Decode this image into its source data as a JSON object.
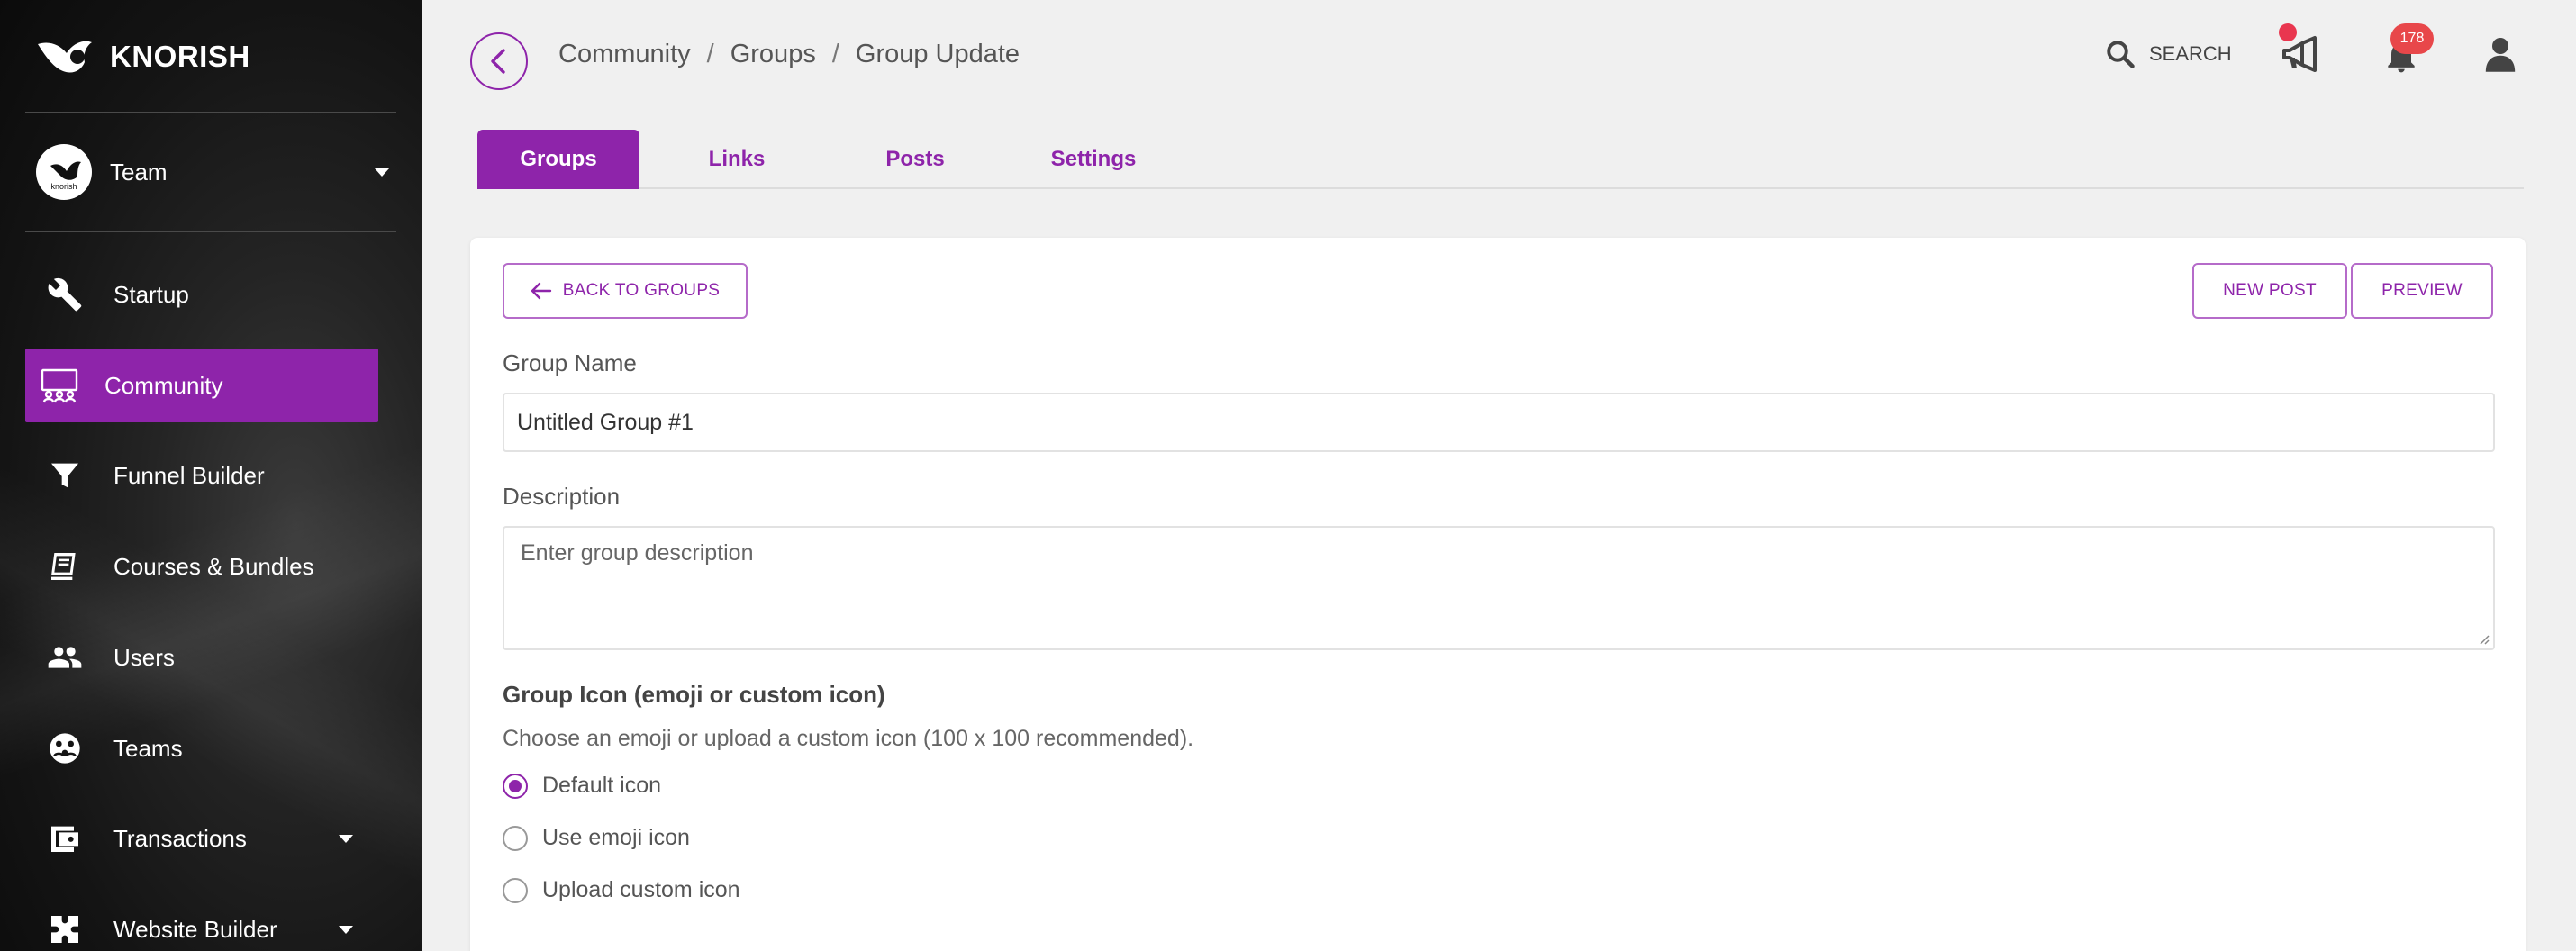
{
  "brand": {
    "name": "KNORISH"
  },
  "team": {
    "label": "Team",
    "avatar_text": "knorish"
  },
  "nav": {
    "items": [
      {
        "label": "Startup"
      },
      {
        "label": "Community"
      },
      {
        "label": "Funnel Builder"
      },
      {
        "label": "Courses & Bundles"
      },
      {
        "label": "Users"
      },
      {
        "label": "Teams"
      },
      {
        "label": "Transactions"
      },
      {
        "label": "Website Builder"
      }
    ]
  },
  "breadcrumb": {
    "items": [
      "Community",
      "Groups",
      "Group Update"
    ],
    "separator": "/"
  },
  "header": {
    "search_label": "SEARCH",
    "notification_count": "178"
  },
  "tabs": [
    {
      "label": "Groups",
      "active": true
    },
    {
      "label": "Links",
      "active": false
    },
    {
      "label": "Posts",
      "active": false
    },
    {
      "label": "Settings",
      "active": false
    }
  ],
  "form": {
    "back_button": "BACK TO GROUPS",
    "new_post_button": "NEW POST",
    "preview_button": "PREVIEW",
    "group_name_label": "Group Name",
    "group_name_value": "Untitled Group #1",
    "description_label": "Description",
    "description_placeholder": "Enter group description",
    "icon_label": "Group Icon (emoji or custom icon)",
    "icon_hint": "Choose an emoji or upload a custom icon (100 x 100 recommended).",
    "icon_options": [
      {
        "label": "Default icon",
        "checked": true
      },
      {
        "label": "Use emoji icon",
        "checked": false
      },
      {
        "label": "Upload custom icon",
        "checked": false
      }
    ]
  },
  "colors": {
    "accent": "#8e24aa",
    "badge": "#e8474a",
    "dot": "#e9364f"
  }
}
